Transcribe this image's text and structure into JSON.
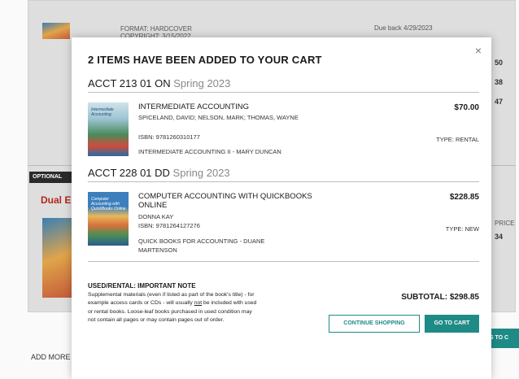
{
  "background": {
    "format": "FORMAT: HARDCOVER",
    "copyright": "COPYRIGHT: 3/15/2022",
    "due_back": "Due back 4/29/2023",
    "optional": "OPTIONAL",
    "dual": "Dual Er",
    "num_50": "50",
    "num_38": "38",
    "num_47": "47",
    "price_label": "PRICE",
    "num_34": "34",
    "right_btn": "MS TO C",
    "add_more": "ADD MORE C"
  },
  "modal": {
    "close": "×",
    "title": "2 ITEMS HAVE BEEN ADDED TO YOUR CART",
    "sections": [
      {
        "course": "ACCT 213 01 ON",
        "term": "Spring 2023",
        "item": {
          "title": "INTERMEDIATE ACCOUNTING",
          "authors": "SPICELAND, DAVID; NELSON, MARK; THOMAS, WAYNE",
          "isbn": "ISBN: 9781260310177",
          "course_name": "INTERMEDIATE ACCOUNTING II - MARY DUNCAN",
          "price": "$70.00",
          "type": "TYPE: RENTAL",
          "cover_text": "Intermediate Accounting"
        }
      },
      {
        "course": "ACCT 228 01 DD",
        "term": "Spring 2023",
        "item": {
          "title": "COMPUTER ACCOUNTING WITH QUICKBOOKS ONLINE",
          "authors": "DONNA KAY",
          "isbn": "ISBN: 9781264127276",
          "course_name": "QUICK BOOKS FOR ACCOUNTING - DUANE MARTENSON",
          "price": "$228.85",
          "type": "TYPE: NEW",
          "cover_text": "Computer Accounting with QuickBooks Online"
        }
      }
    ],
    "note_head": "USED/RENTAL: IMPORTANT NOTE",
    "note_part1": "Supplemental materials (even if listed as part of the book's title) - for example access cards or CDs - will usually ",
    "note_not": "not",
    "note_part2": " be included with used or rental books. Loose-leaf books purchased in used condition may not contain all pages or may contain pages out of order.",
    "subtotal": "SUBTOTAL: $298.85",
    "continue_label": "CONTINUE SHOPPING",
    "cart_label": "GO TO CART"
  }
}
